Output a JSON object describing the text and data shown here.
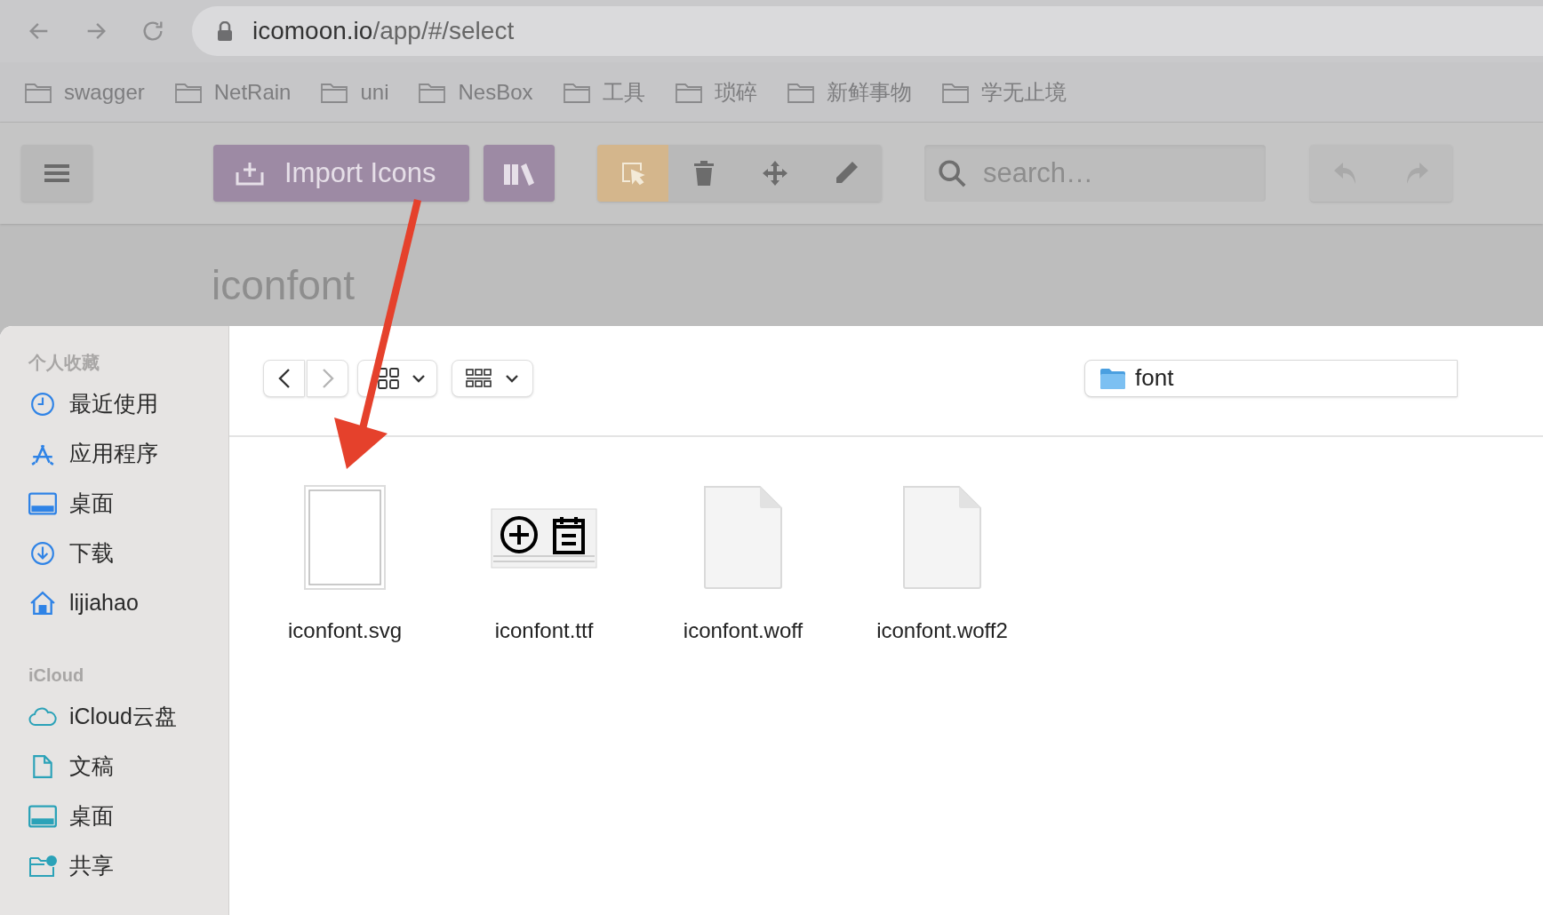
{
  "browser": {
    "url_host": "icomoon.io",
    "url_path": "/app/#/select",
    "bookmarks": [
      {
        "label": "swagger"
      },
      {
        "label": "NetRain"
      },
      {
        "label": "uni"
      },
      {
        "label": "NesBox"
      },
      {
        "label": "工具"
      },
      {
        "label": "琐碎"
      },
      {
        "label": "新鲜事物"
      },
      {
        "label": "学无止境"
      }
    ]
  },
  "app_toolbar": {
    "import_label": "Import Icons",
    "search_placeholder": "search…",
    "tools": [
      {
        "kind": "select",
        "selected": true
      },
      {
        "kind": "delete",
        "selected": false
      },
      {
        "kind": "move",
        "selected": false
      },
      {
        "kind": "edit",
        "selected": false
      }
    ]
  },
  "project_title": "iconfont",
  "dialog": {
    "sidebar": [
      {
        "heading": "个人收藏",
        "items": [
          {
            "label": "最近使用",
            "kind": "clock"
          },
          {
            "label": "应用程序",
            "kind": "apps"
          },
          {
            "label": "桌面",
            "kind": "desktop"
          },
          {
            "label": "下载",
            "kind": "download"
          },
          {
            "label": "lijiahao",
            "kind": "home"
          }
        ]
      },
      {
        "heading": "iCloud",
        "items": [
          {
            "label": "iCloud云盘",
            "kind": "cloud"
          },
          {
            "label": "文稿",
            "kind": "document"
          },
          {
            "label": "桌面",
            "kind": "desktop"
          },
          {
            "label": "共享",
            "kind": "shared"
          }
        ]
      }
    ],
    "location": "font",
    "files": [
      {
        "name": "iconfont.svg",
        "kind": "blank-page"
      },
      {
        "name": "iconfont.ttf",
        "kind": "font-preview"
      },
      {
        "name": "iconfont.woff",
        "kind": "document"
      },
      {
        "name": "iconfont.woff2",
        "kind": "document"
      }
    ]
  }
}
